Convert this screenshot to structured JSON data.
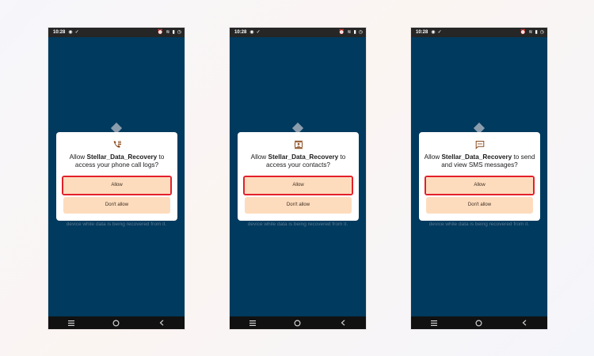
{
  "status_bar": {
    "time": "10:28"
  },
  "screens": [
    {
      "id": "call-logs",
      "icon": "call-log-icon",
      "title_prefix": "Allow ",
      "app_name": "Stellar_Data_Recovery",
      "title_suffix": " to access your phone call logs?",
      "allow_label": "Allow",
      "deny_label": "Don't allow",
      "background_text": "device while data is being recovered from it."
    },
    {
      "id": "contacts",
      "icon": "contacts-icon",
      "title_prefix": "Allow ",
      "app_name": "Stellar_Data_Recovery",
      "title_suffix": " to access your contacts?",
      "allow_label": "Allow",
      "deny_label": "Don't allow",
      "background_text": "device while data is being recovered from it."
    },
    {
      "id": "sms",
      "icon": "sms-icon",
      "title_prefix": "Allow ",
      "app_name": "Stellar_Data_Recovery",
      "title_suffix": " to send and view SMS messages?",
      "allow_label": "Allow",
      "deny_label": "Don't allow",
      "background_text": "device while data is being recovered from it."
    }
  ],
  "colors": {
    "screen_bg": "#003a5e",
    "button_bg": "#fddcbd",
    "highlight": "#e3202a",
    "icon": "#8a4b1e"
  }
}
